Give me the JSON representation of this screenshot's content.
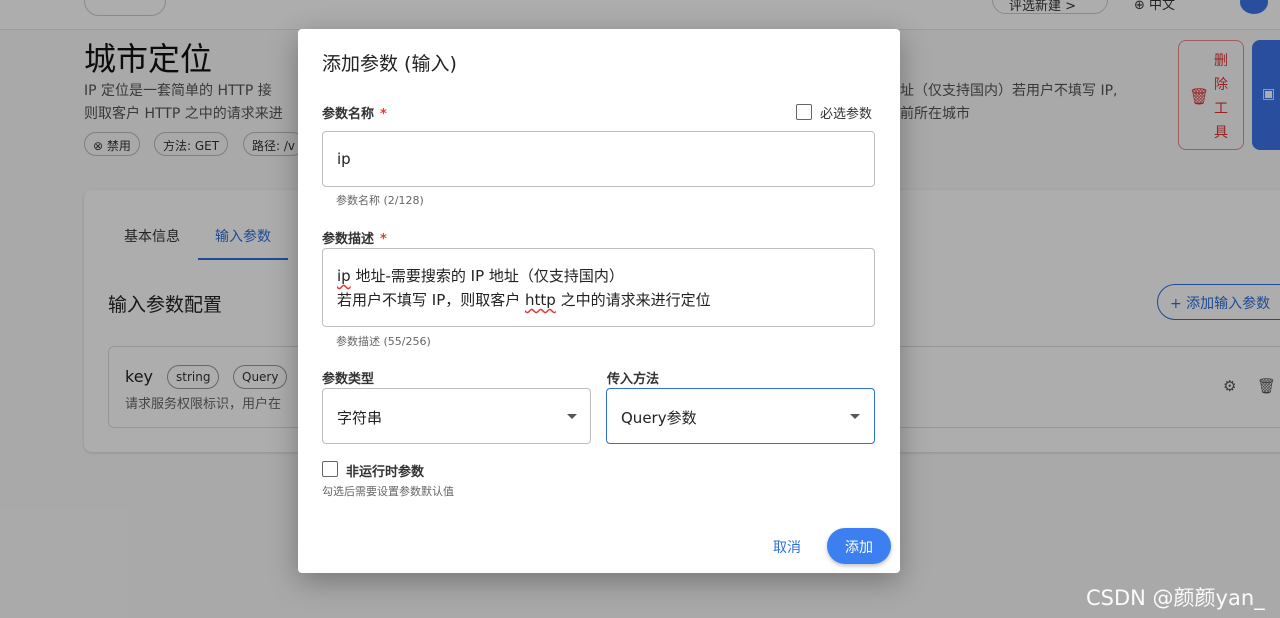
{
  "background": {
    "top_button": "评选新建 >",
    "top_lang": "中文",
    "page_title": "城市定位",
    "desc_line1_left": "IP 定位是一套简单的 HTTP 接",
    "desc_line1_right": "址（仅支持国内）若用户不填写 IP,",
    "desc_line2_left": "则取客户 HTTP 之中的请求来进",
    "desc_line2_right": "前所在城市",
    "chips": [
      "⊗ 禁用",
      "方法: GET",
      "路径: /v"
    ],
    "delete_tool_label": "删除工具",
    "tabs": [
      "基本信息",
      "输入参数"
    ],
    "section_title": "输入参数配置",
    "add_input_button": "+ 添加输入参数",
    "param_row": {
      "name": "key",
      "type_chip": "string",
      "method_chip": "Query",
      "desc": "请求服务权限标识，用户在"
    }
  },
  "dialog": {
    "title": "添加参数 (输入)",
    "name_label": "参数名称",
    "required_mark": "*",
    "required_checkbox_label": "必选参数",
    "name_value": "ip",
    "name_helper": "参数名称 (2/128)",
    "desc_label": "参数描述",
    "desc_line1_a": "ip",
    "desc_line1_b": " 地址-需要搜索的 IP 地址（仅支持国内）",
    "desc_line2_a": "若用户不填写 IP，则取客户 ",
    "desc_line2_b": "http",
    "desc_line2_c": " 之中的请求来进行定位",
    "desc_helper": "参数描述 (55/256)",
    "type_label": "参数类型",
    "type_value": "字符串",
    "method_label": "传入方法",
    "method_value": "Query参数",
    "non_runtime_label": "非运行时参数",
    "non_runtime_helper": "勾选后需要设置参数默认值",
    "cancel_label": "取消",
    "add_label": "添加"
  },
  "watermark": "CSDN @颜颜yan_",
  "colors": {
    "primary": "#3b7ff0",
    "danger": "#e53935",
    "overlay": "rgba(0,0,0,0.32)"
  },
  "icons": [
    "trash-icon",
    "save-icon",
    "plus-icon",
    "gear-icon",
    "dropdown-arrow-icon",
    "block-icon"
  ]
}
